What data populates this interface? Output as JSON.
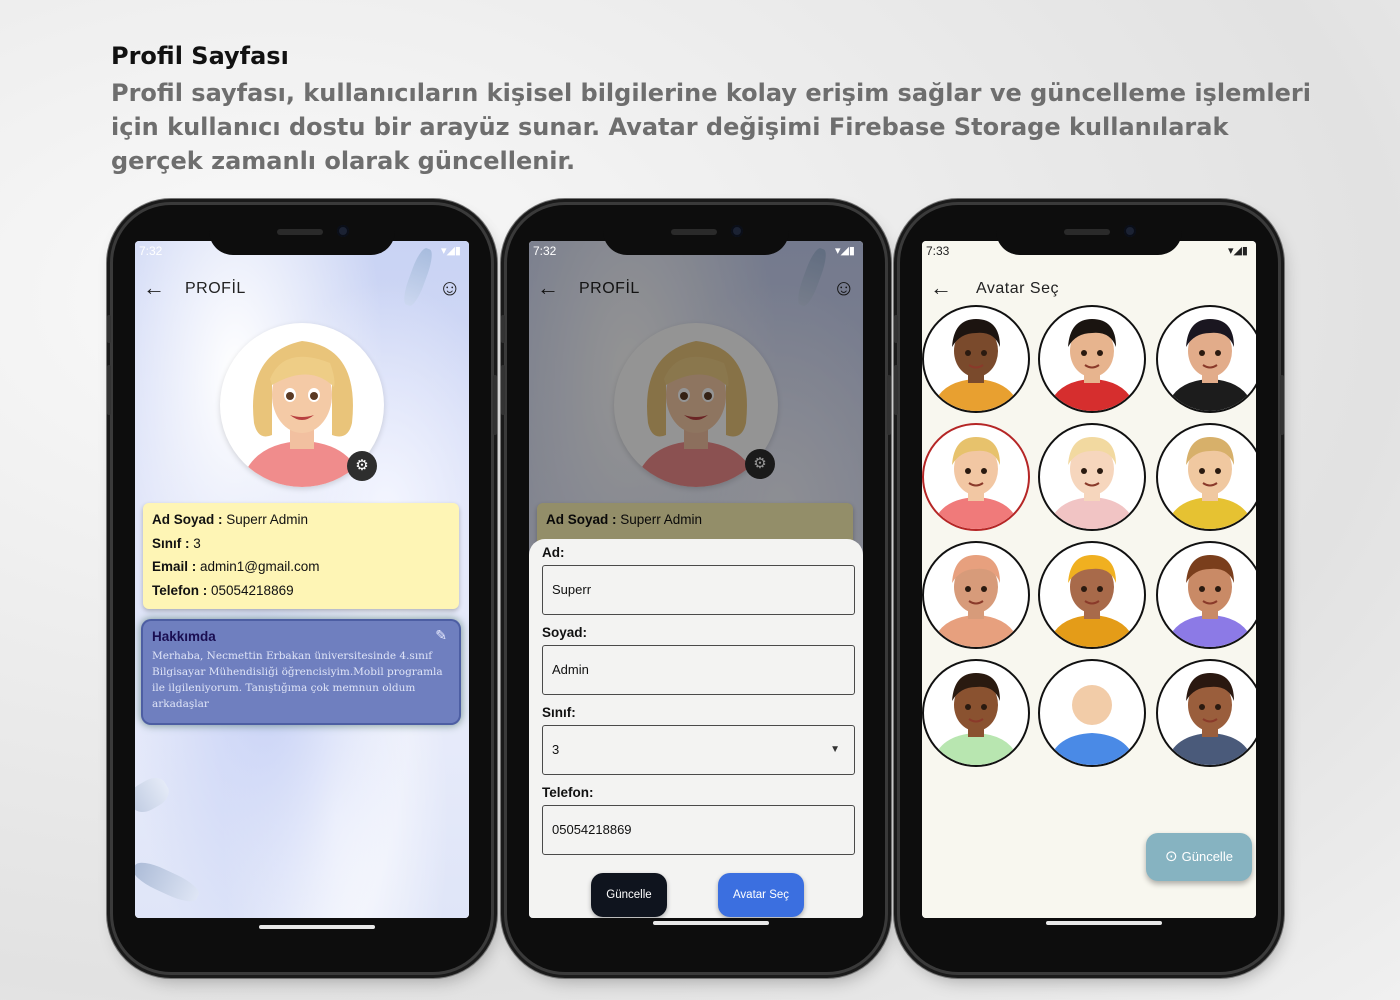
{
  "header": {
    "title": "Profil Sayfası",
    "description": "Profil sayfası, kullanıcıların kişisel bilgilerine kolay erişim sağlar ve güncelleme işlemleri için kullanıcı dostu bir arayüz sunar. Avatar değişimi Firebase Storage kullanılarak gerçek zamanlı olarak güncellenir."
  },
  "screen1": {
    "status_time": "7:32",
    "appbar_title": "PROFİL",
    "info": {
      "ad_soyad_label": "Ad Soyad :",
      "ad_soyad_value": " Superr Admin",
      "sinif_label": "Sınıf :",
      "sinif_value": " 3",
      "email_label": "Email :",
      "email_value": " admin1@gmail.com",
      "telefon_label": "Telefon :",
      "telefon_value": " 05054218869"
    },
    "about": {
      "title": "Hakkımda",
      "text": "Merhaba,  Necmettin Erbakan üniversitesinde 4.sınıf Bilgisayar Mühendisliği öğrencisiyim.Mobil programla ile ilgileniyorum. Tanıştığıma çok memnun oldum arkadaşlar"
    }
  },
  "screen2": {
    "status_time": "7:32",
    "appbar_title": "PROFİL",
    "peek_label": "Ad Soyad :",
    "peek_value": " Superr Admin",
    "form": {
      "ad_label": "Ad:",
      "ad_value": "Superr",
      "soyad_label": "Soyad:",
      "soyad_value": "Admin",
      "sinif_label": "Sınıf:",
      "sinif_value": "3",
      "telefon_label": "Telefon:",
      "telefon_value": "05054218869"
    },
    "buttons": {
      "update": "Güncelle",
      "avatar": "Avatar Seç"
    }
  },
  "screen3": {
    "status_time": "7:33",
    "appbar_title": "Avatar Seç",
    "fab_label": "Güncelle",
    "avatars": [
      {
        "skin": "#7a4a2c",
        "hair": "#1c1410",
        "shirt": "#e8a030"
      },
      {
        "skin": "#e7b48e",
        "hair": "#1a1410",
        "shirt": "#d62e2e"
      },
      {
        "skin": "#e2ac8a",
        "hair": "#1a1620",
        "shirt": "#1c1c1c"
      },
      {
        "skin": "#f2c7a3",
        "hair": "#e7c26c",
        "shirt": "#f07a7a",
        "selected": true
      },
      {
        "skin": "#f6d6bd",
        "hair": "#f2d9a0",
        "shirt": "#f1c4c4"
      },
      {
        "skin": "#f0c8a0",
        "hair": "#d7b06a",
        "shirt": "#e6c232"
      },
      {
        "skin": "#d79b7a",
        "hair": "#e7a07e",
        "shirt": "#e7a07e"
      },
      {
        "skin": "#a86a4a",
        "hair": "#f0b020",
        "shirt": "#e49c18"
      },
      {
        "skin": "#c98a66",
        "hair": "#7a3e1c",
        "shirt": "#8c7ae6"
      },
      {
        "skin": "#8a5230",
        "hair": "#2a1a10",
        "shirt": "#b8e6b0"
      },
      {
        "skin": "#f2cca8",
        "hair": "#f2cca8",
        "shirt": "#4a8ae6"
      },
      {
        "skin": "#9a5e3c",
        "hair": "#2a1810",
        "shirt": "#4a5a7a"
      }
    ]
  },
  "colors": {
    "info_card_bg": "#fef5b5",
    "about_card_bg": "#6f7fbf",
    "update_button": "#0f141e",
    "avatar_button": "#3b6fe0",
    "fab_bg": "#86b3c1",
    "avatar_bg": "#f8f7ef"
  }
}
